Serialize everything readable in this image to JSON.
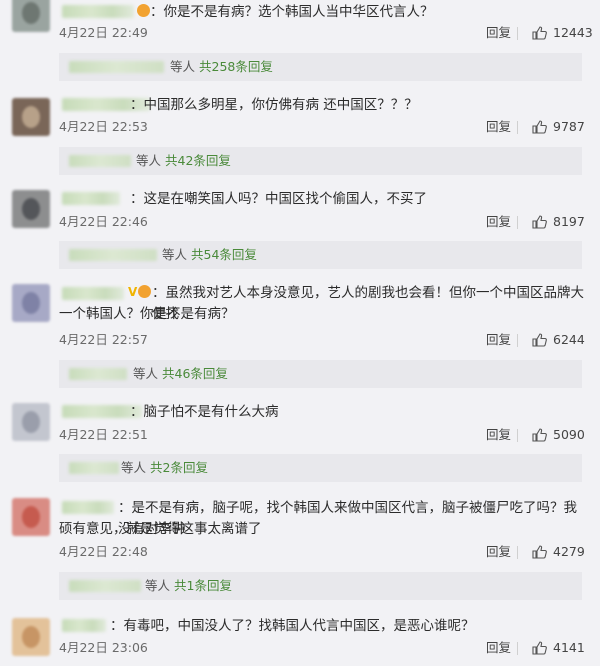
{
  "comments": [
    {
      "badges": "",
      "content": "：你是不是有病？选个韩国人当中华区代言人？",
      "content2": "",
      "time": "4月22日 22:49",
      "reply_label": "回复",
      "likes": "12443",
      "replies_prefix": "等人",
      "replies_count": "共258条回复"
    },
    {
      "badges": "",
      "content": "：中国那么多明星，你仿佛有病 还中国区？？？",
      "content2": "",
      "time": "4月22日 22:53",
      "reply_label": "回复",
      "likes": "9787",
      "replies_prefix": "等人",
      "replies_count": "共42条回复"
    },
    {
      "badges": "",
      "content": "：这是在嘲笑国人吗？中国区找个偷国人，不买了",
      "content2": "",
      "time": "4月22日 22:46",
      "reply_label": "回复",
      "likes": "8197",
      "replies_prefix": "等人",
      "replies_count": "共54条回复"
    },
    {
      "badges": "V",
      "content": "：虽然我对艺人本身没意见，艺人的剧我也会看！但你一个中国区品牌大使找",
      "content2": "一个韩国人？你是不是有病？",
      "time": "4月22日 22:57",
      "reply_label": "回复",
      "likes": "6244",
      "replies_prefix": "等人",
      "replies_count": "共46条回复"
    },
    {
      "badges": "",
      "content": "：脑子怕不是有什么大病",
      "content2": "",
      "time": "4月22日 22:51",
      "reply_label": "回复",
      "likes": "5090",
      "replies_prefix": "等人",
      "replies_count": "共2条回复"
    },
    {
      "badges": "",
      "content": "：是不是有病，脑子呢，找个韩国人来做中国区代言，脑子被僵尸吃了吗？我没有对李钟",
      "content2": "硕有意见，就是觉得这事太离谱了",
      "time": "4月22日 22:48",
      "reply_label": "回复",
      "likes": "4279",
      "replies_prefix": "等人",
      "replies_count": "共1条回复"
    },
    {
      "badges": "",
      "content": "：有毒吧，中国没人了？找韩国人代言中国区，是恶心谁呢？",
      "content2": "",
      "time": "4月22日 23:06",
      "reply_label": "回复",
      "likes": "4141",
      "replies_prefix": "",
      "replies_count": ""
    }
  ]
}
